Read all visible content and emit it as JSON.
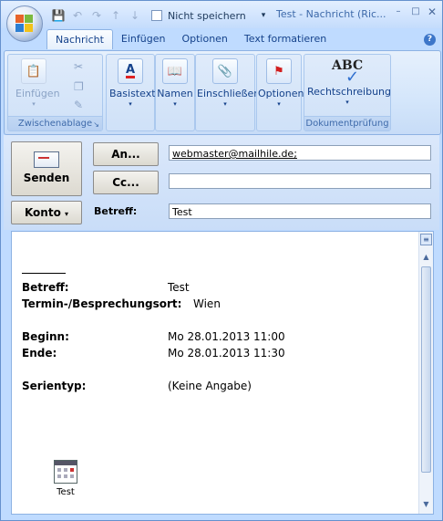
{
  "window": {
    "title": "Test - Nachricht (Ric...",
    "dont_save_label": "Nicht speichern"
  },
  "tabs": [
    "Nachricht",
    "Einfügen",
    "Optionen",
    "Text formatieren"
  ],
  "ribbon": {
    "clipboard": {
      "paste_label": "Einfügen",
      "group_label": "Zwischenablage"
    },
    "basic_text_label": "Basistext",
    "names_label": "Namen",
    "include_label": "Einschließen",
    "options_label": "Optionen",
    "spelling_label": "Rechtschreibung",
    "proofing_group_label": "Dokumentprüfung",
    "spelling_icon_text": "ABC"
  },
  "header": {
    "send_label": "Senden",
    "to_button": "An...",
    "cc_button": "Cc...",
    "account_button": "Konto",
    "subject_label": "Betreff:",
    "to_value": "webmaster@mailhile.de;",
    "cc_value": "",
    "subject_value": "Test"
  },
  "body": {
    "subject_label": "Betreff:",
    "subject_value": "Test",
    "location_label": "Termin-/Besprechungsort:",
    "location_value": "Wien",
    "start_label": "Beginn:",
    "start_value": "Mo 28.01.2013 11:00",
    "end_label": "Ende:",
    "end_value": "Mo 28.01.2013 11:30",
    "recurrence_label": "Serientyp:",
    "recurrence_value": "(Keine Angabe)",
    "attachment_name": "Test"
  }
}
